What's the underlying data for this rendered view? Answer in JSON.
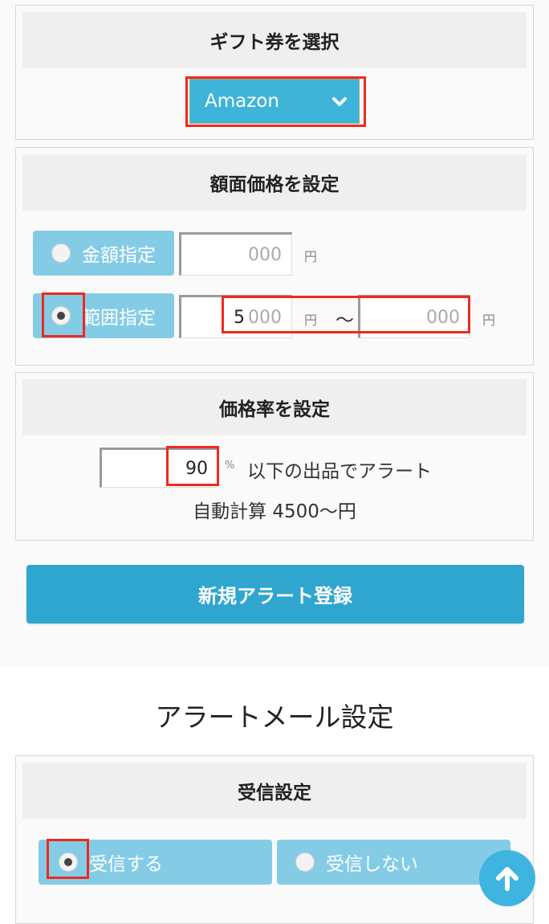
{
  "gift_section": {
    "title": "ギフト券を選択",
    "selected": "Amazon"
  },
  "face_value_section": {
    "title": "額面価格を設定",
    "exact_option": {
      "label": "金額指定",
      "checked": false
    },
    "exact_placeholder": "000",
    "range_option": {
      "label": "範囲指定",
      "checked": true
    },
    "range_min_value": "5",
    "range_min_placeholder": "000",
    "range_separator": "〜",
    "range_max_placeholder": "000",
    "yen_unit": "円"
  },
  "rate_section": {
    "title": "価格率を設定",
    "rate_value": "90",
    "percent_unit": "%",
    "alert_text": "以下の出品でアラート",
    "auto_calc_text": "自動計算 4500〜円"
  },
  "register_button": "新規アラート登録",
  "alert_mail": {
    "heading": "アラートメール設定",
    "receive_section_title": "受信設定",
    "receive_option": {
      "label": "受信する",
      "checked": true
    },
    "no_receive_option": {
      "label": "受信しない",
      "checked": false
    }
  },
  "colors": {
    "accent": "#3eb4d8",
    "button": "#2fa6cf",
    "option": "#84cce6",
    "highlight": "#f0281e"
  },
  "icons": {
    "dropdown": "chevron-down-icon",
    "scroll_top": "arrow-up-icon"
  }
}
